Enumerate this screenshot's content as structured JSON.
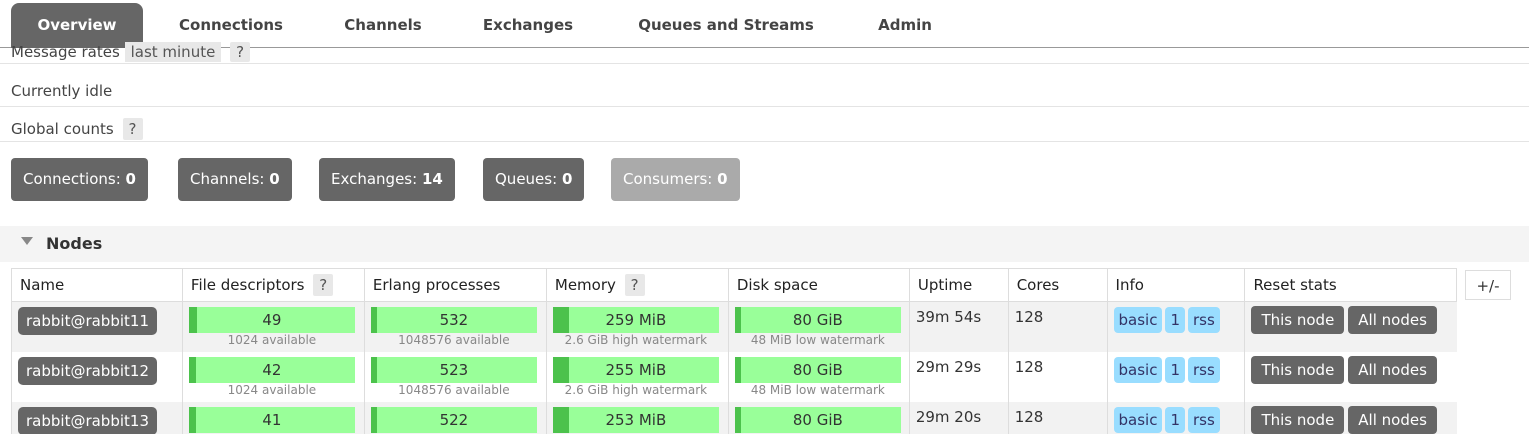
{
  "tabs": [
    {
      "label": "Overview",
      "active": true
    },
    {
      "label": "Connections"
    },
    {
      "label": "Channels"
    },
    {
      "label": "Exchanges"
    },
    {
      "label": "Queues and Streams"
    },
    {
      "label": "Admin"
    }
  ],
  "message_rates": {
    "label": "Message rates",
    "period": "last minute",
    "help": "?"
  },
  "idle_text": "Currently idle",
  "global_counts": {
    "label": "Global counts",
    "help": "?"
  },
  "counts": [
    {
      "label": "Connections:",
      "value": "0"
    },
    {
      "label": "Channels:",
      "value": "0"
    },
    {
      "label": "Exchanges:",
      "value": "14"
    },
    {
      "label": "Queues:",
      "value": "0"
    },
    {
      "label": "Consumers:",
      "value": "0"
    }
  ],
  "nodes_section": {
    "title": "Nodes"
  },
  "table": {
    "headers": [
      "Name",
      "File descriptors",
      "Erlang processes",
      "Memory",
      "Disk space",
      "Uptime",
      "Cores",
      "Info",
      "Reset stats"
    ],
    "help": "?",
    "toggle": "+/-",
    "rows": [
      {
        "name": "rabbit@rabbit11",
        "fd": "49",
        "fd_sub": "1024 available",
        "fd_fill": 0.048,
        "proc": "532",
        "proc_sub": "1048576 available",
        "proc_fill": 0.005,
        "mem": "259 MiB",
        "mem_sub": "2.6 GiB high watermark",
        "mem_fill": 0.097,
        "disk": "80 GiB",
        "disk_sub": "48 MiB low watermark",
        "disk_fill": 0.0,
        "uptime": "39m 54s",
        "cores": "128",
        "info": [
          "basic",
          "1",
          "rss"
        ],
        "reset": [
          "This node",
          "All nodes"
        ]
      },
      {
        "name": "rabbit@rabbit12",
        "fd": "42",
        "fd_sub": "1024 available",
        "fd_fill": 0.041,
        "proc": "523",
        "proc_sub": "1048576 available",
        "proc_fill": 0.005,
        "mem": "255 MiB",
        "mem_sub": "2.6 GiB high watermark",
        "mem_fill": 0.096,
        "disk": "80 GiB",
        "disk_sub": "48 MiB low watermark",
        "disk_fill": 0.0,
        "uptime": "29m 29s",
        "cores": "128",
        "info": [
          "basic",
          "1",
          "rss"
        ],
        "reset": [
          "This node",
          "All nodes"
        ]
      },
      {
        "name": "rabbit@rabbit13",
        "fd": "41",
        "fd_sub": "",
        "fd_fill": 0.04,
        "proc": "522",
        "proc_sub": "",
        "proc_fill": 0.005,
        "mem": "253 MiB",
        "mem_sub": "",
        "mem_fill": 0.095,
        "disk": "80 GiB",
        "disk_sub": "",
        "disk_fill": 0.0,
        "uptime": "29m 20s",
        "cores": "128",
        "info": [
          "basic",
          "1",
          "rss"
        ],
        "reset": [
          "This node",
          "All nodes"
        ]
      }
    ]
  },
  "colors": {
    "tab_active": "#666666",
    "bar": "#99ff99",
    "bar_fill": "#4cc24c",
    "info_badge": "#99ddff",
    "button": "#666666"
  }
}
